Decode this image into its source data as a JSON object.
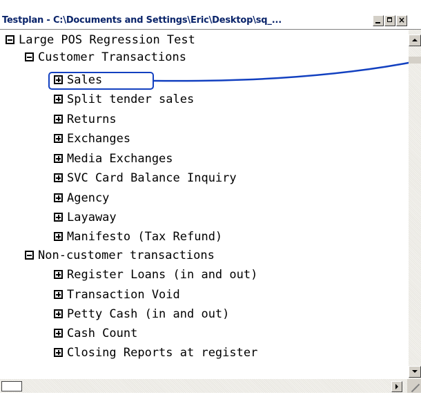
{
  "window": {
    "title": "Testplan - C:\\Documents and Settings\\Eric\\Desktop\\sq_...",
    "minimize_glyph": "minimize-icon",
    "maximize_glyph": "maximize-icon",
    "close_glyph": "×"
  },
  "tree": {
    "items": [
      {
        "label": "Large POS Regression Test",
        "state": "expanded",
        "level": 0
      },
      {
        "label": "Customer Transactions",
        "state": "expanded",
        "level": 1
      },
      {
        "label": "Sales",
        "state": "collapsed",
        "level": 2,
        "highlighted": true
      },
      {
        "label": "Split tender sales",
        "state": "collapsed",
        "level": 2
      },
      {
        "label": "Returns",
        "state": "collapsed",
        "level": 2
      },
      {
        "label": "Exchanges",
        "state": "collapsed",
        "level": 2
      },
      {
        "label": "Media Exchanges",
        "state": "collapsed",
        "level": 2
      },
      {
        "label": "SVC Card Balance Inquiry",
        "state": "collapsed",
        "level": 2
      },
      {
        "label": "Agency",
        "state": "collapsed",
        "level": 2
      },
      {
        "label": "Layaway",
        "state": "collapsed",
        "level": 2
      },
      {
        "label": "Manifesto (Tax Refund)",
        "state": "collapsed",
        "level": 2
      },
      {
        "label": "Non-customer transactions",
        "state": "expanded",
        "level": 1
      },
      {
        "label": "Register Loans (in and out)",
        "state": "collapsed",
        "level": 2
      },
      {
        "label": "Transaction Void",
        "state": "collapsed",
        "level": 2
      },
      {
        "label": "Petty Cash (in and out)",
        "state": "collapsed",
        "level": 2
      },
      {
        "label": "Cash Count",
        "state": "collapsed",
        "level": 2
      },
      {
        "label": "Closing Reports at register",
        "state": "collapsed",
        "level": 2
      }
    ]
  },
  "colors": {
    "title_text": "#0a246a",
    "highlight_border": "#1240c0",
    "chrome": "#d4d0c8"
  }
}
